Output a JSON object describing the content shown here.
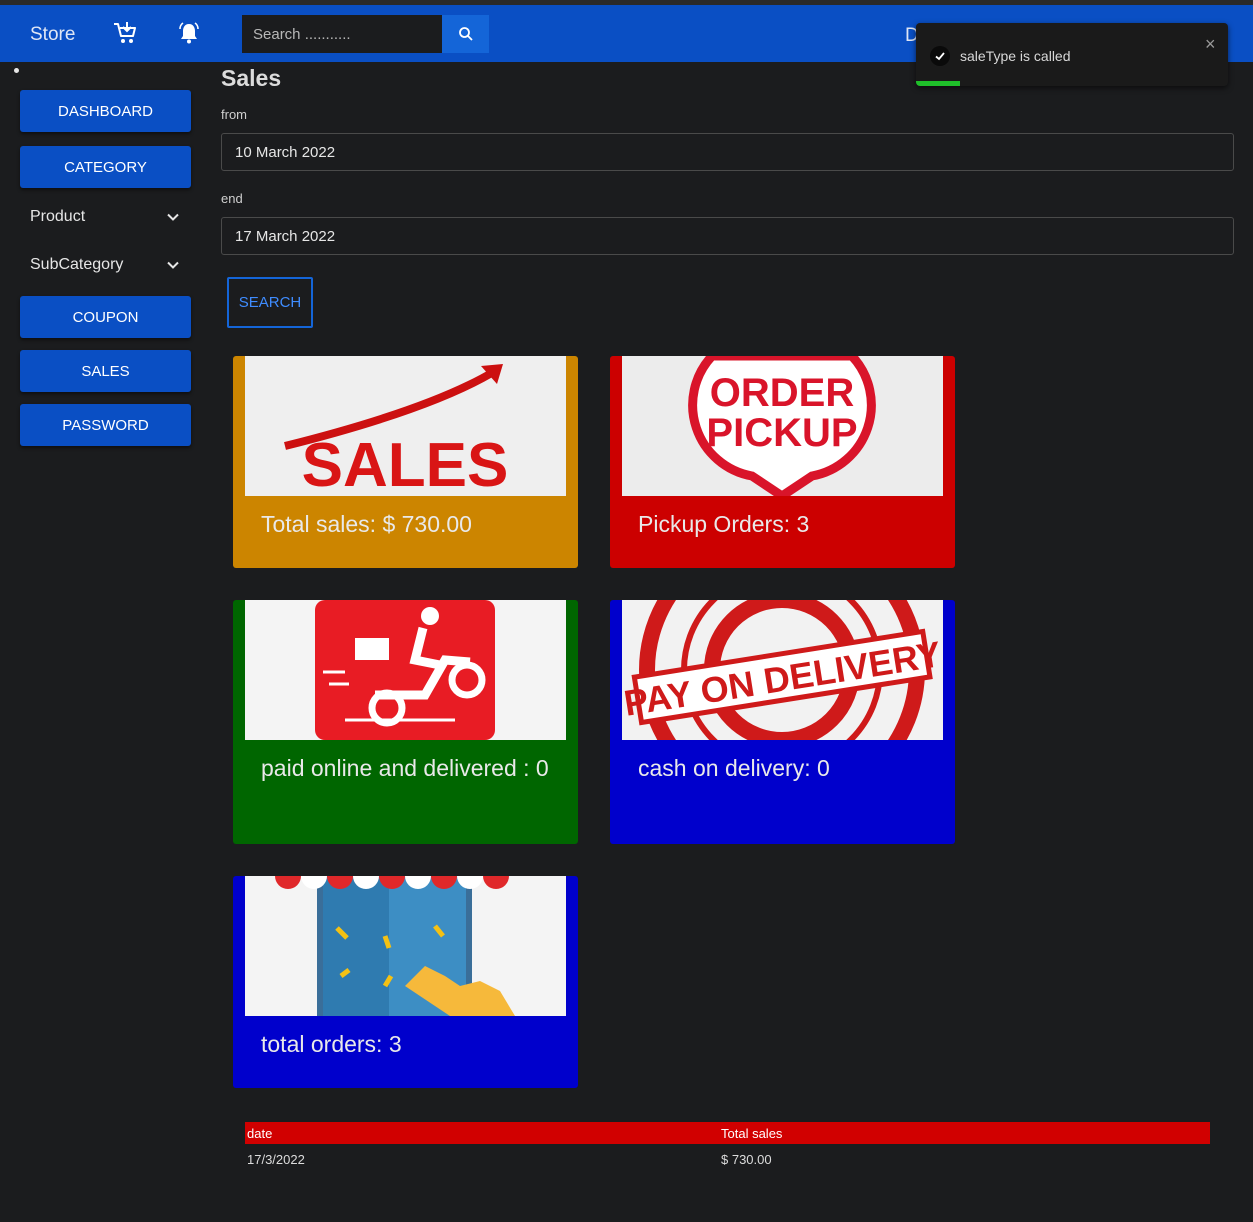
{
  "navbar": {
    "brand": "Store",
    "search_placeholder": "Search ...........",
    "user_initial": "D",
    "icons": [
      "cart-icon",
      "bell-icon",
      "search-icon"
    ],
    "color": "#0a4fc4"
  },
  "toast": {
    "message": "saleType is called",
    "close": "×",
    "progress": 0.14
  },
  "sidebar": {
    "dashboard": "DASHBOARD",
    "category": "CATEGORY",
    "product": "Product",
    "subcategory": "SubCategory",
    "coupon": "COUPON",
    "sales": "SALES",
    "password": "PASSWORD"
  },
  "main": {
    "title": "Sales",
    "from_label": "from",
    "from_value": "10 March 2022",
    "end_label": "end",
    "end_value": "17 March 2022",
    "search_button": "SEARCH"
  },
  "cards": {
    "total_sales": {
      "text": "Total sales: $ 730.00",
      "color": "#cc8500",
      "image_text": "SALES"
    },
    "pickup": {
      "text": "Pickup Orders: 3",
      "color": "#cc0000",
      "image_text_1": "ORDER",
      "image_text_2": "PICKUP"
    },
    "paid_online": {
      "text": "paid online and delivered : 0",
      "color": "#006600"
    },
    "cod": {
      "text": "cash on delivery: 0",
      "color": "#0000cc",
      "image_text": "PAY ON DELIVERY"
    },
    "total_orders": {
      "text": "total orders: 3",
      "color": "#0000cc"
    }
  },
  "table": {
    "headers": [
      "date",
      "Total sales"
    ],
    "rows": [
      [
        "17/3/2022",
        "$ 730.00"
      ]
    ],
    "header_color": "#d10000"
  }
}
